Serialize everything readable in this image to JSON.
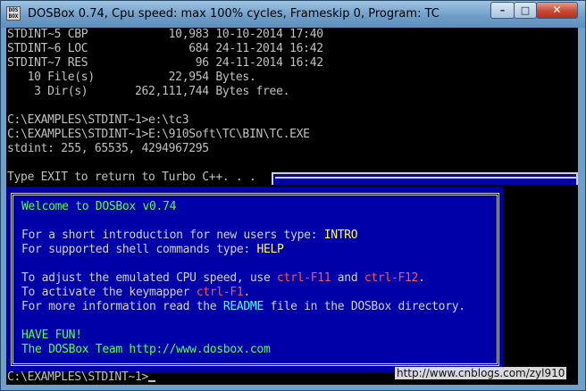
{
  "window": {
    "title": "DOSBox 0.74, Cpu speed: max 100% cycles, Frameskip  0, Program:     TC",
    "icon_lines": [
      "DOS",
      "BOX"
    ],
    "controls": {
      "minimize": "–",
      "maximize": "□",
      "close": "✕"
    }
  },
  "console": {
    "lines": [
      "STDINT~5 CBP            10,983 10-10-2014 17:40",
      "STDINT~6 LOC               684 24-11-2014 16:42",
      "STDINT~7 RES                96 24-11-2014 16:42",
      "   10 File(s)           22,954 Bytes.",
      "    3 Dir(s)       262,111,744 Bytes free.",
      "",
      "C:\\EXAMPLES\\STDINT~1>e:\\tc3",
      "C:\\EXAMPLES\\STDINT~1>E:\\910Soft\\TC\\BIN\\TC.EXE",
      "stdint: 255, 65535, 4294967295",
      "",
      "Type EXIT to return to Turbo C++. . ."
    ],
    "prompt": "C:\\EXAMPLES\\STDINT~1>"
  },
  "welcome": {
    "heading": "Welcome to DOSBox v0.74",
    "intro_pre": "For a short introduction for new users type: ",
    "intro_cmd": "INTRO",
    "help_pre": "For supported shell commands type: ",
    "help_cmd": "HELP",
    "cpu_pre": "To adjust the emulated CPU speed, use ",
    "cpu_key1": "ctrl-F11",
    "cpu_mid": " and ",
    "cpu_key2": "ctrl-F12",
    "cpu_end": ".",
    "map_pre": "To activate the keymapper ",
    "map_key": "ctrl-F1",
    "map_end": ".",
    "info_pre": "For more information read the ",
    "info_readme": "README",
    "info_end": " file in the DOSBox directory.",
    "fun": "HAVE FUN!",
    "team": "The DOSBox Team http://www.dosbox.com"
  },
  "watermark": "http://www.cnblogs.com/zyl910"
}
